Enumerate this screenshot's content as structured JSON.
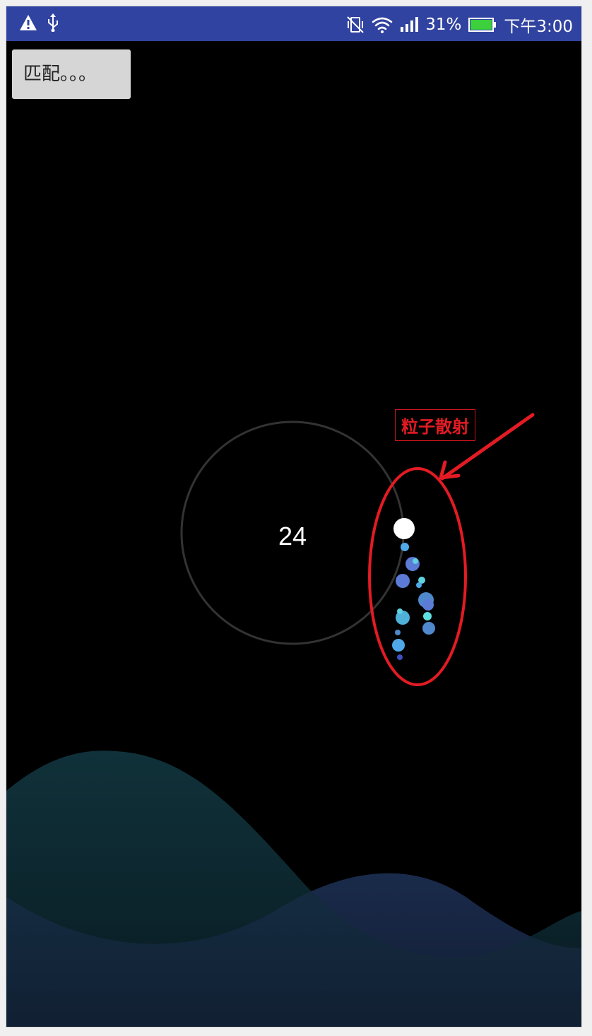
{
  "status_bar": {
    "battery_percent": "31%",
    "time": "下午3:00",
    "icons": [
      "warning-icon",
      "usb-icon",
      "vibrate-off-icon",
      "wifi-icon",
      "signal-icon",
      "battery-icon"
    ],
    "background": "#3143a0",
    "battery_color": "#3cd13c"
  },
  "match_button": {
    "label": "匹配。。。"
  },
  "countdown": {
    "value": "24"
  },
  "annotation": {
    "label": "粒子散射",
    "color": "#e31b23"
  },
  "colors": {
    "background": "#000000",
    "ring": "#333333",
    "wave_front": "#123a44",
    "wave_back": "#1b2a4a",
    "particle_palette": [
      "#ffffff",
      "#4fa8e8",
      "#5c7bd6",
      "#5fd0e0",
      "#3f6fc7"
    ]
  }
}
